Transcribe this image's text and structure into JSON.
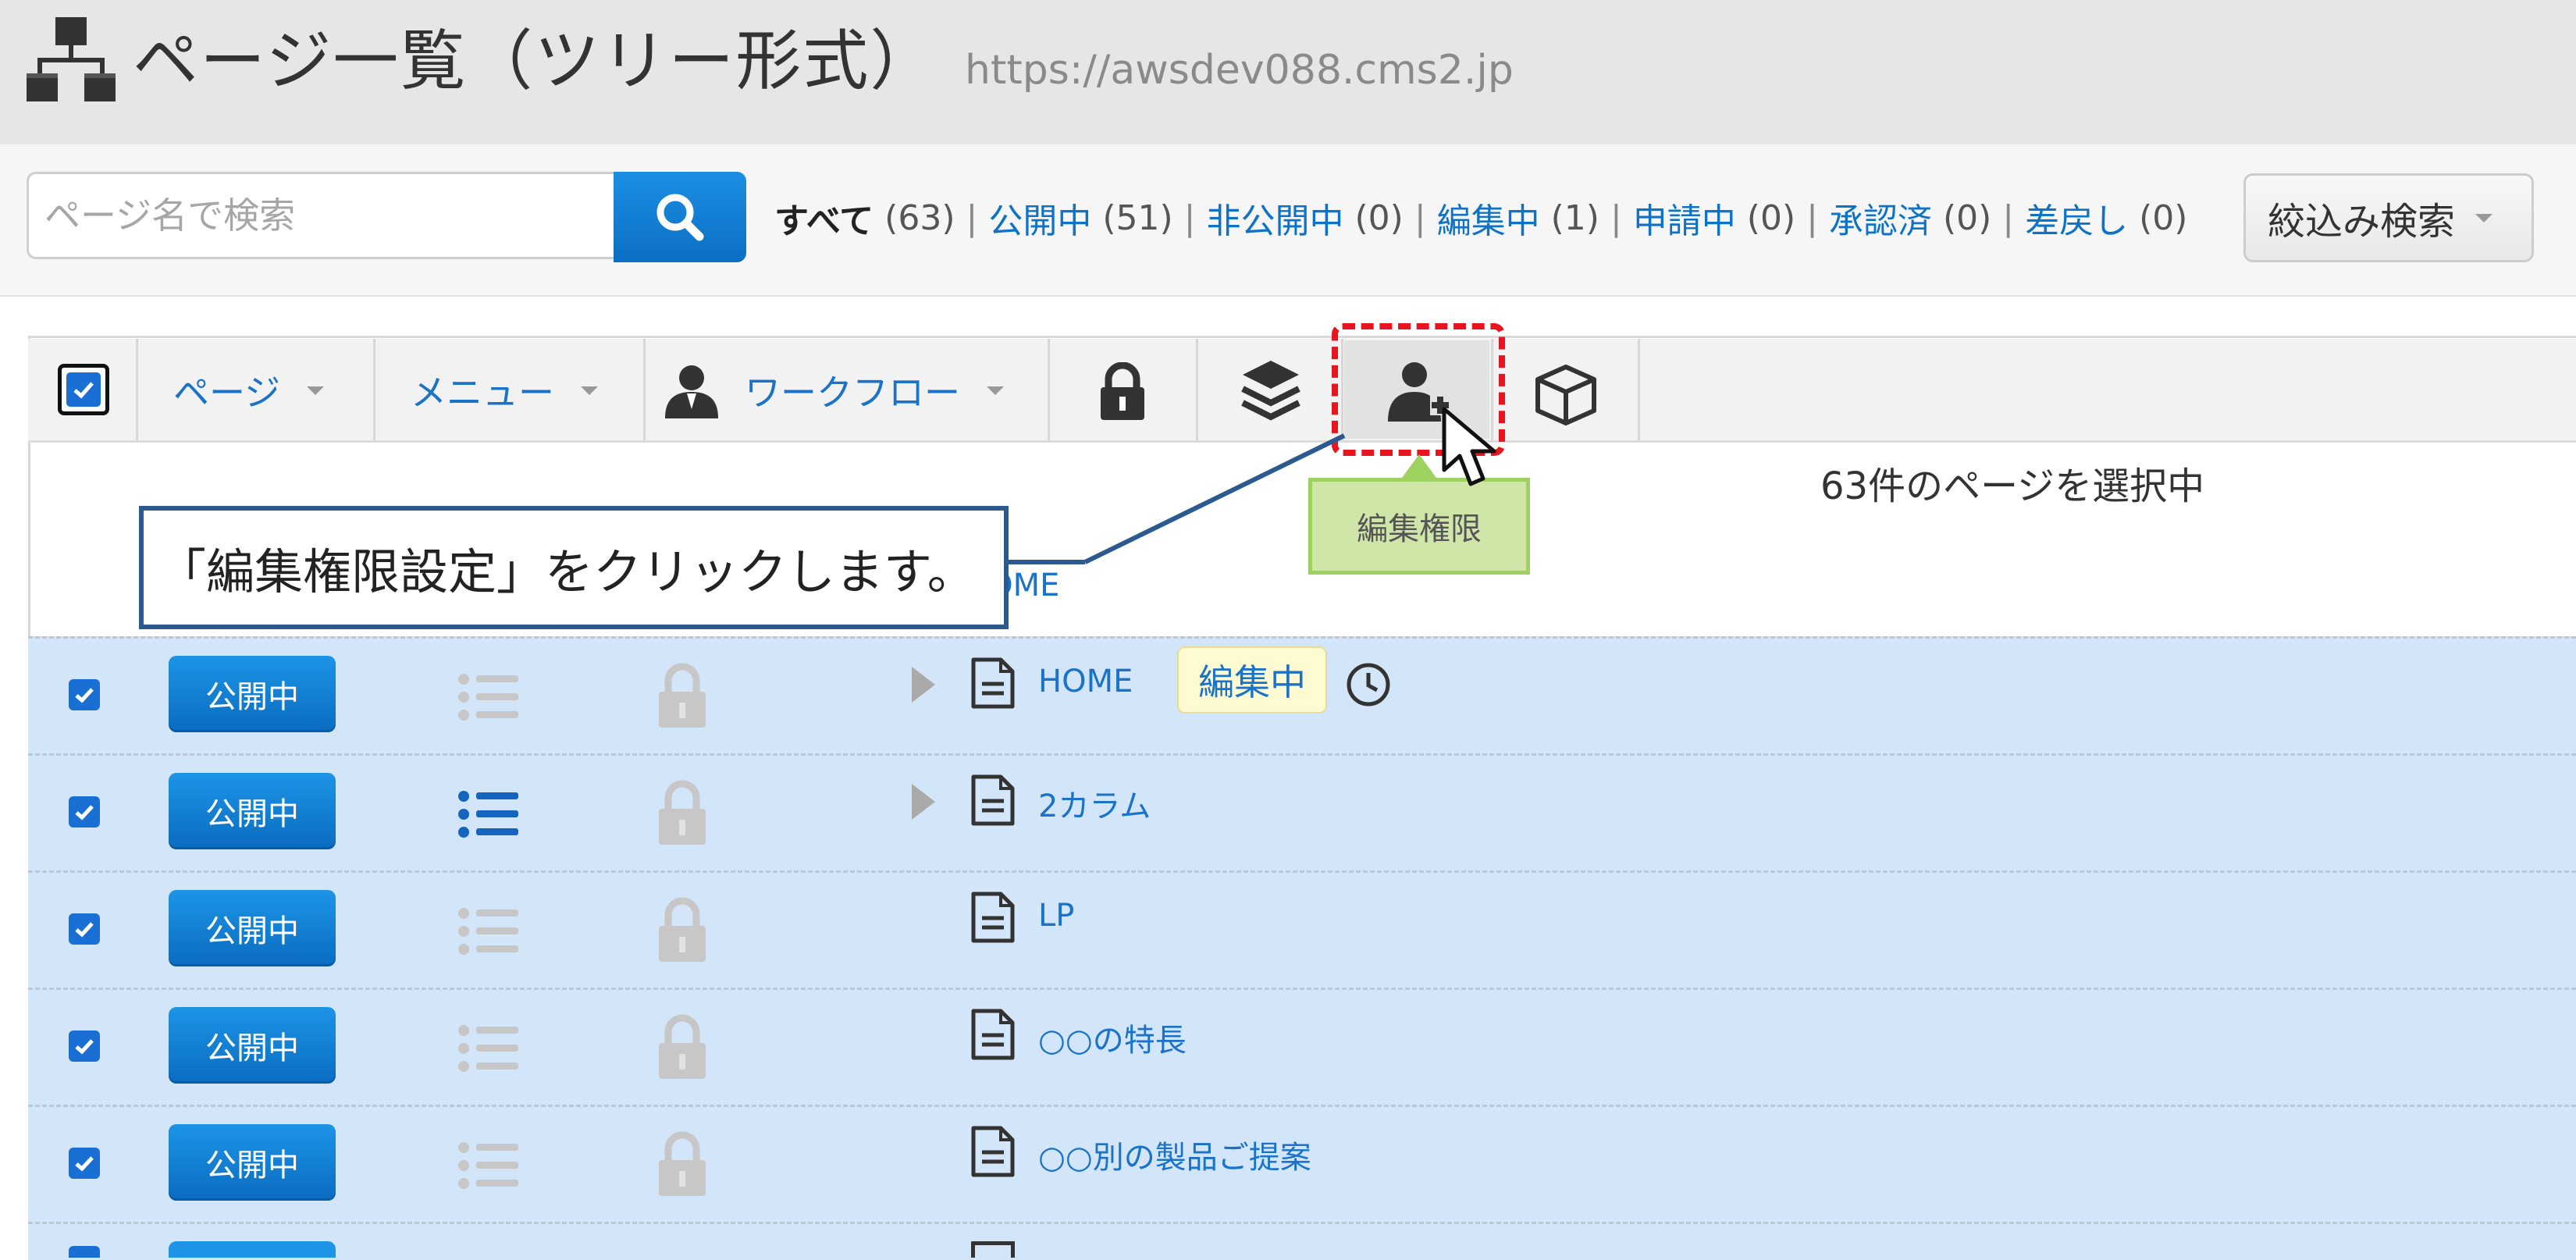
{
  "header": {
    "title": "ページ一覧（ツリー形式）",
    "site_url": "https://awsdev088.cms2.jp"
  },
  "search": {
    "placeholder": "ページ名で検索",
    "value": ""
  },
  "status_filters": [
    {
      "label": "すべて",
      "count": "(63)",
      "active": true
    },
    {
      "label": "公開中",
      "count": "(51)"
    },
    {
      "label": "非公開中",
      "count": "(0)"
    },
    {
      "label": "編集中",
      "count": "(1)"
    },
    {
      "label": "申請中",
      "count": "(0)"
    },
    {
      "label": "承認済",
      "count": "(0)"
    },
    {
      "label": "差戻し",
      "count": "(0)"
    }
  ],
  "narrow_search": {
    "label": "絞込み検索"
  },
  "toolbar": {
    "page_menu": "ページ",
    "menu_menu": "メニュー",
    "workflow_menu": "ワークフロー",
    "tooltip": "編集権限"
  },
  "selection_count": "63件のページを選択中",
  "breadcrumb": {
    "home": "HOME"
  },
  "rows": [
    {
      "status": "公開中",
      "title": "HOME",
      "badge": "編集中",
      "menu_active": false,
      "expandable": true
    },
    {
      "status": "公開中",
      "title": "2カラム",
      "menu_active": true,
      "expandable": true
    },
    {
      "status": "公開中",
      "title": "LP",
      "menu_active": false,
      "expandable": false
    },
    {
      "status": "公開中",
      "title": "○○の特長",
      "menu_active": false,
      "expandable": false
    },
    {
      "status": "公開中",
      "title": "○○別の製品ご提案",
      "menu_active": false,
      "expandable": false
    }
  ],
  "annotation": {
    "callout": "「編集権限設定」をクリックします。"
  },
  "colors": {
    "accent": "#0e72c7",
    "status_button": "#0a6cc0",
    "row_selected": "#d3e5f8",
    "highlight": "#e8141f",
    "tooltip_bg": "#cfe6a8"
  }
}
